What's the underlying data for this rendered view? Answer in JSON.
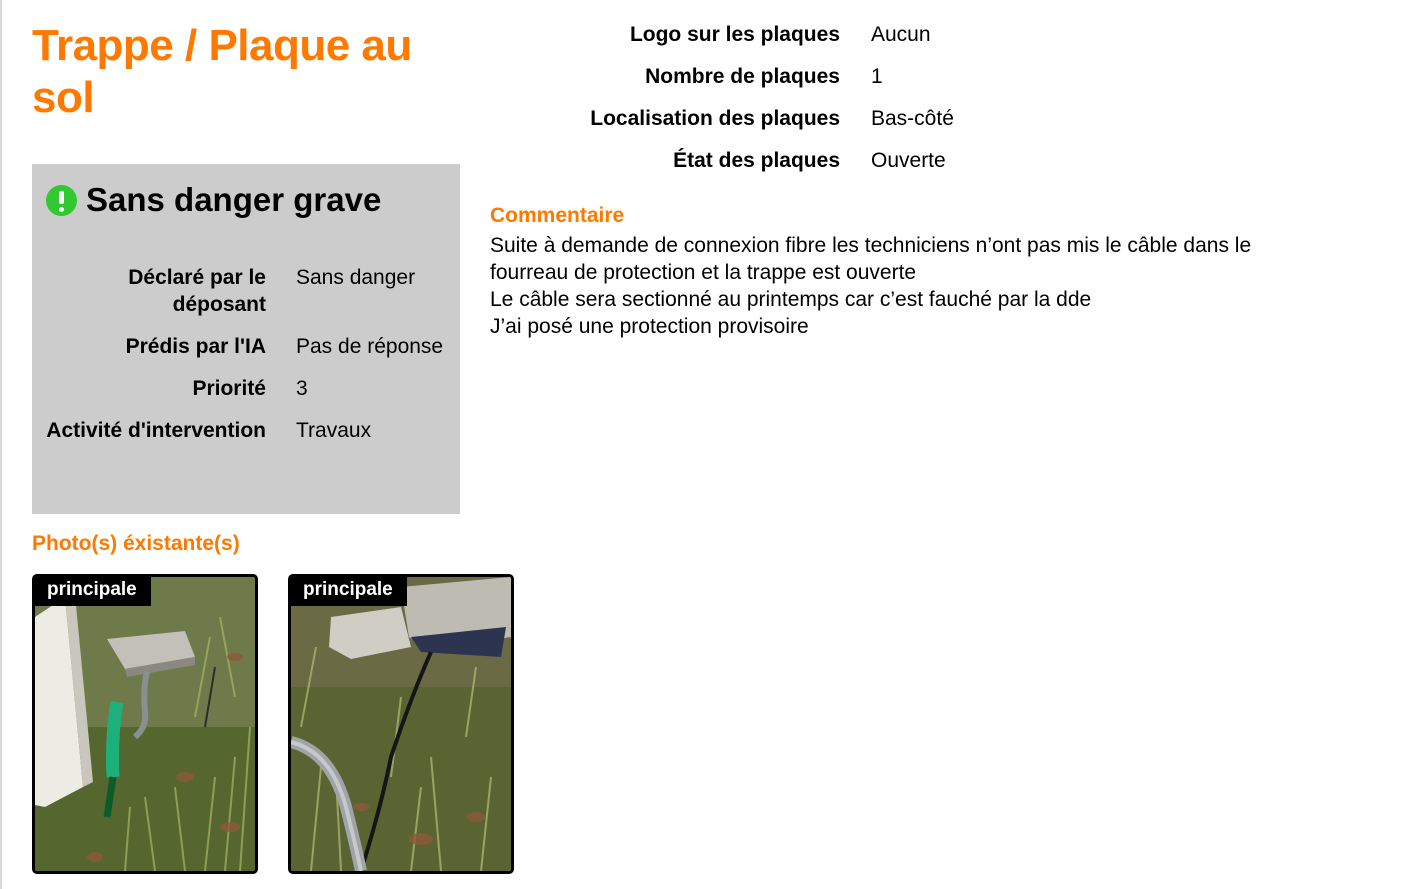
{
  "page": {
    "title": "Trappe / Plaque au sol"
  },
  "status": {
    "icon": "alert-icon",
    "title": "Sans danger grave",
    "details": [
      {
        "label": "Déclaré par le déposant",
        "value": "Sans danger"
      },
      {
        "label": "Prédis par l'IA",
        "value": "Pas de réponse"
      },
      {
        "label": "Priorité",
        "value": "3"
      },
      {
        "label": "Activité d'intervention",
        "value": "Travaux"
      }
    ]
  },
  "photos": {
    "title": "Photo(s) éxistante(s)",
    "items": [
      {
        "badge": "principale"
      },
      {
        "badge": "principale"
      }
    ]
  },
  "properties": [
    {
      "label": "Logo sur les plaques",
      "value": "Aucun"
    },
    {
      "label": "Nombre de plaques",
      "value": "1"
    },
    {
      "label": "Localisation des plaques",
      "value": "Bas-côté"
    },
    {
      "label": "État des plaques",
      "value": "Ouverte"
    }
  ],
  "comment": {
    "label": "Commentaire",
    "lines": [
      "Suite à demande de connexion fibre les techniciens n’ont pas mis le câble dans le",
      "fourreau de protection et la trappe est ouverte",
      "Le câble sera sectionné au printemps car c’est fauché par la dde",
      "J’ai posé une protection provisoire"
    ]
  },
  "colors": {
    "accent": "#ff7900",
    "status_box": "#cccccc",
    "alert_icon": "#32c832"
  }
}
